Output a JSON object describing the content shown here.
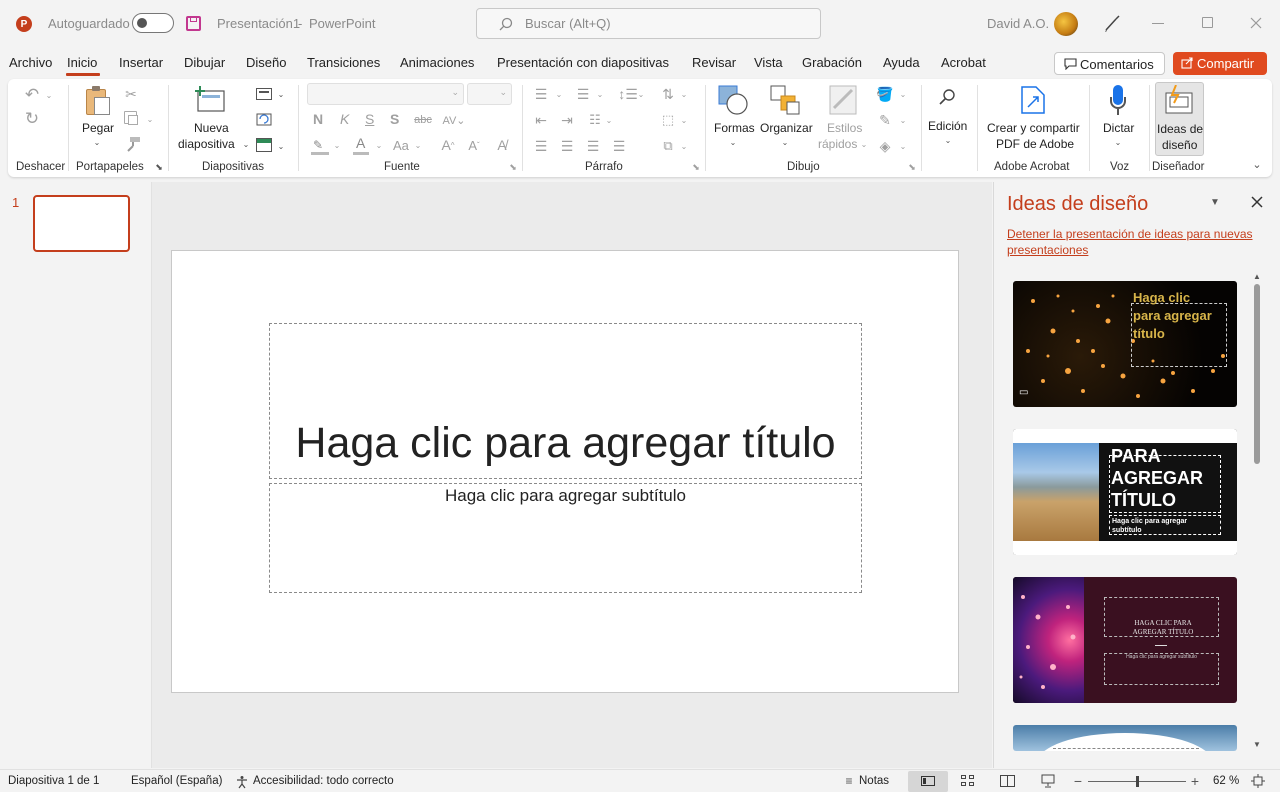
{
  "titlebar": {
    "autosave_label": "Autoguardado",
    "doc_title": "Presentación1",
    "separator": "-",
    "app_name": "PowerPoint",
    "search_placeholder": "Buscar (Alt+Q)",
    "user_name": "David A.O."
  },
  "menu": {
    "tabs": [
      "Archivo",
      "Inicio",
      "Insertar",
      "Dibujar",
      "Diseño",
      "Transiciones",
      "Animaciones",
      "Presentación con diapositivas",
      "Revisar",
      "Vista",
      "Grabación",
      "Ayuda",
      "Acrobat"
    ],
    "active_tab": "Inicio",
    "comments_label": "Comentarios",
    "share_label": "Compartir"
  },
  "ribbon": {
    "groups": {
      "undo": "Deshacer",
      "clipboard": "Portapapeles",
      "slides": "Diapositivas",
      "font": "Fuente",
      "paragraph": "Párrafo",
      "drawing": "Dibujo",
      "acrobat": "Adobe Acrobat",
      "voice": "Voz",
      "designer": "Diseñador"
    },
    "paste_label": "Pegar",
    "new_slide_line1": "Nueva",
    "new_slide_line2": "diapositiva",
    "shapes_label": "Formas",
    "arrange_label": "Organizar",
    "quick_styles_line1": "Estilos",
    "quick_styles_line2": "rápidos",
    "editing_label": "Edición",
    "create_pdf_line1": "Crear y compartir",
    "create_pdf_line2": "PDF de Adobe",
    "dictate_label": "Dictar",
    "design_ideas_line1": "Ideas de",
    "design_ideas_line2": "diseño",
    "bold": "N",
    "italic": "K",
    "underline": "S",
    "strike": "S",
    "font_case": "Aa"
  },
  "thumbnails": [
    {
      "number": "1"
    }
  ],
  "slide": {
    "title_placeholder": "Haga clic para agregar título",
    "subtitle_placeholder": "Haga clic para agregar subtítulo"
  },
  "design_pane": {
    "title": "Ideas de diseño",
    "stop_link": "Detener la presentación de ideas para nuevas presentaciones",
    "idea1_title": "Haga clic para agregar título",
    "idea2_title": "PARA AGREGAR TÍTULO",
    "idea2_subtitle": "Haga clic para agregar subtítulo",
    "idea3_title": "HAGA CLIC PARA AGREGAR TÍTULO",
    "idea3_subtitle": "Haga clic para agregar subtítulo"
  },
  "status": {
    "slide_counter": "Diapositiva 1 de 1",
    "language": "Español (España)",
    "accessibility": "Accesibilidad: todo correcto",
    "notes_label": "Notas",
    "zoom_level": "62 %",
    "zoom_fraction": 0.5
  },
  "colors": {
    "accent_red": "#c43e1c",
    "share_bg": "#e04a1f",
    "link_red": "#c43e1c"
  }
}
